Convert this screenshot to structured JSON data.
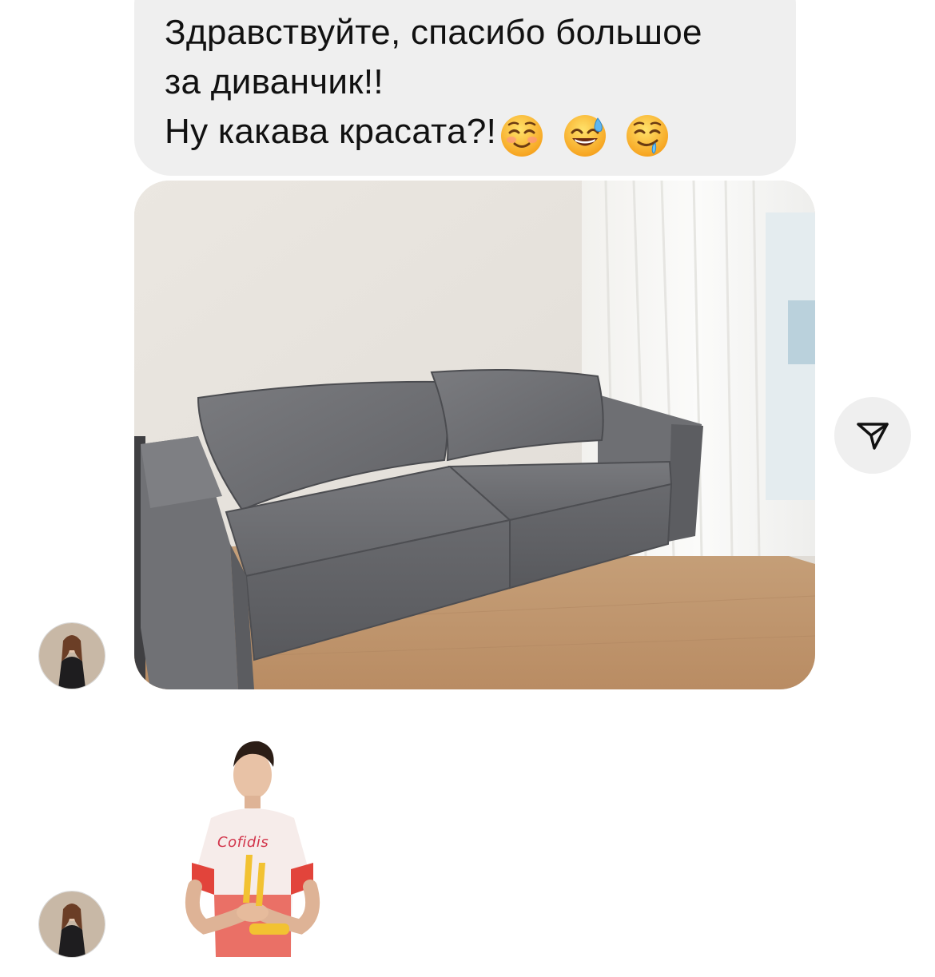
{
  "message": {
    "lines": [
      "Здравствуйте, спасибо большое",
      "за диванчик!!",
      "Ну какава красата?!"
    ],
    "emojis": [
      "smiling-face-icon",
      "grinning-sweat-icon",
      "drooling-face-icon"
    ]
  },
  "photo": {
    "subject": "grey-sofa-photo"
  },
  "share": {
    "icon": "paper-plane-icon"
  },
  "sticker": {
    "jersey_text": "Cofidis"
  },
  "colors": {
    "bubble": "#efefef",
    "text": "#111111",
    "sofa": "#6b6c70",
    "floor": "#c49d78",
    "wall": "#e6e2dc"
  }
}
